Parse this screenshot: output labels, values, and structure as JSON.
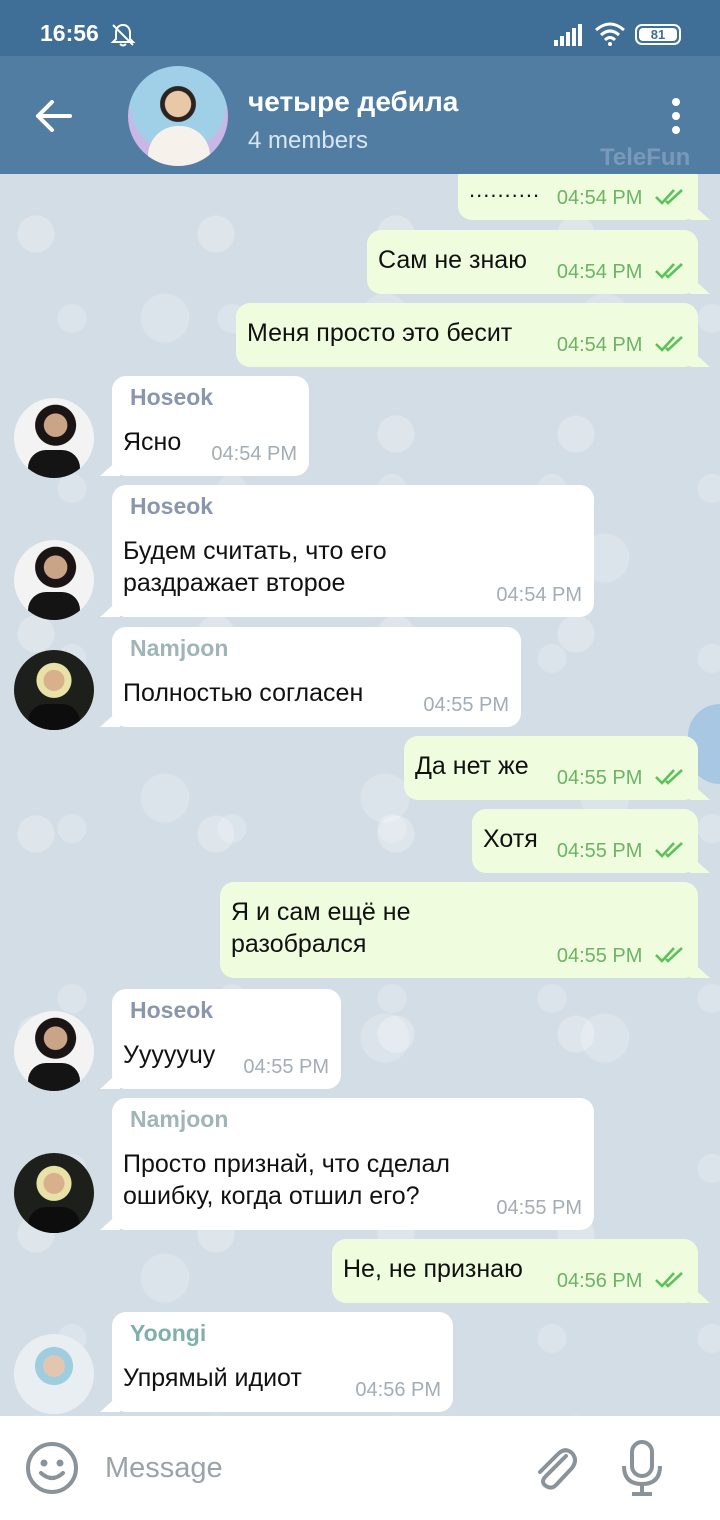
{
  "status_bar": {
    "time": "16:56",
    "battery": "81",
    "icons": [
      "bell-off-icon",
      "signal-icon",
      "wifi-icon",
      "battery-icon"
    ]
  },
  "header": {
    "title": "четыре дебила",
    "subtitle": "4 members",
    "watermark": "TeleFun"
  },
  "messages": [
    {
      "direction": "out",
      "text": "..........",
      "time": "04:54 PM",
      "read": true
    },
    {
      "direction": "out",
      "text": "Сам не знаю",
      "time": "04:54 PM",
      "read": true
    },
    {
      "direction": "out",
      "text": "Меня просто это бесит",
      "time": "04:54 PM",
      "read": true
    },
    {
      "direction": "in",
      "sender": "Hoseok",
      "text": "Ясно",
      "time": "04:54 PM"
    },
    {
      "direction": "in",
      "sender": "Hoseok",
      "lines": [
        "Будем считать, что его",
        "раздражает второе"
      ],
      "time": "04:54 PM"
    },
    {
      "direction": "in",
      "sender": "Namjoon",
      "text": "Полностью согласен",
      "time": "04:55 PM"
    },
    {
      "direction": "out",
      "text": "Да нет же",
      "time": "04:55 PM",
      "read": true
    },
    {
      "direction": "out",
      "text": "Хотя",
      "time": "04:55 PM",
      "read": true
    },
    {
      "direction": "out",
      "lines": [
        "Я и сам ещё не",
        "разобрался"
      ],
      "time": "04:55 PM",
      "read": true
    },
    {
      "direction": "in",
      "sender": "Hoseok",
      "text": "Уууууuy",
      "time": "04:55 PM"
    },
    {
      "direction": "in",
      "sender": "Namjoon",
      "lines": [
        "Просто признай, что сделал",
        "ошибку, когда отшил его?"
      ],
      "time": "04:55 PM"
    },
    {
      "direction": "out",
      "text": "Не, не признаю",
      "time": "04:56 PM",
      "read": true
    },
    {
      "direction": "in",
      "sender": "Yoongi",
      "text": "Упрямый идиот",
      "time": "04:56 PM"
    }
  ],
  "sender_colors": {
    "Hoseok": "#8a96ad",
    "Namjoon": "#9fb5b8",
    "Yoongi": "#7fb0ad"
  },
  "input": {
    "placeholder": "Message"
  },
  "colors": {
    "header": "#527da3",
    "status_bar": "#3f6e96",
    "bubble_out": "#effdde",
    "bubble_in": "#ffffff",
    "read_check": "#5dc15a"
  }
}
